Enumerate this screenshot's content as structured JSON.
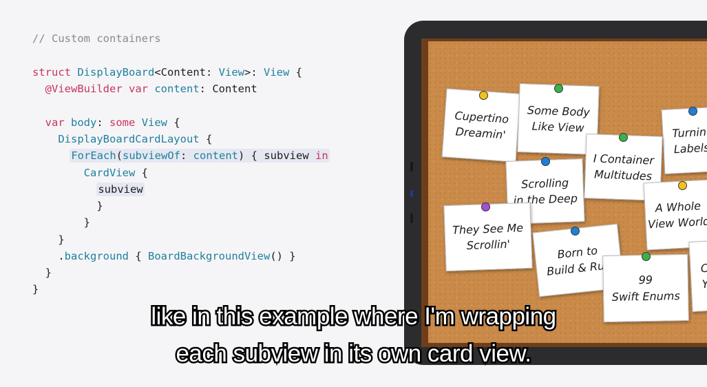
{
  "code_lines": [
    "// Custom containers",
    "struct DisplayBoard<Content: View>: View {",
    "  @ViewBuilder var content: Content",
    "  var body: some View {",
    "    DisplayBoardCardLayout {",
    "      ForEach(subviewOf: content) { subview in",
    "        CardView {",
    "          subview",
    "        }",
    "      }",
    "    }",
    "    .background { BoardBackgroundView() }",
    "  }",
    "}"
  ],
  "cards": [
    "Cupertino\nDreamin'",
    "Some Body\nLike View",
    "I Container\nMultitudes",
    "Scrolling\nin the Deep",
    "Turnin'\nLabels",
    "A Whole\nView World",
    "They See Me\nScrollin'",
    "Born to\nBuild & Run",
    "99\nSwift Enums",
    "C\nY"
  ],
  "pin_colors": {
    "yellow": "#f2c21b",
    "green": "#38b34a",
    "blue": "#1e7fd6",
    "purple": "#a34fd6"
  },
  "caption": {
    "line1": "like in this example where I'm wrapping",
    "line2": "each subview in its own card view."
  }
}
